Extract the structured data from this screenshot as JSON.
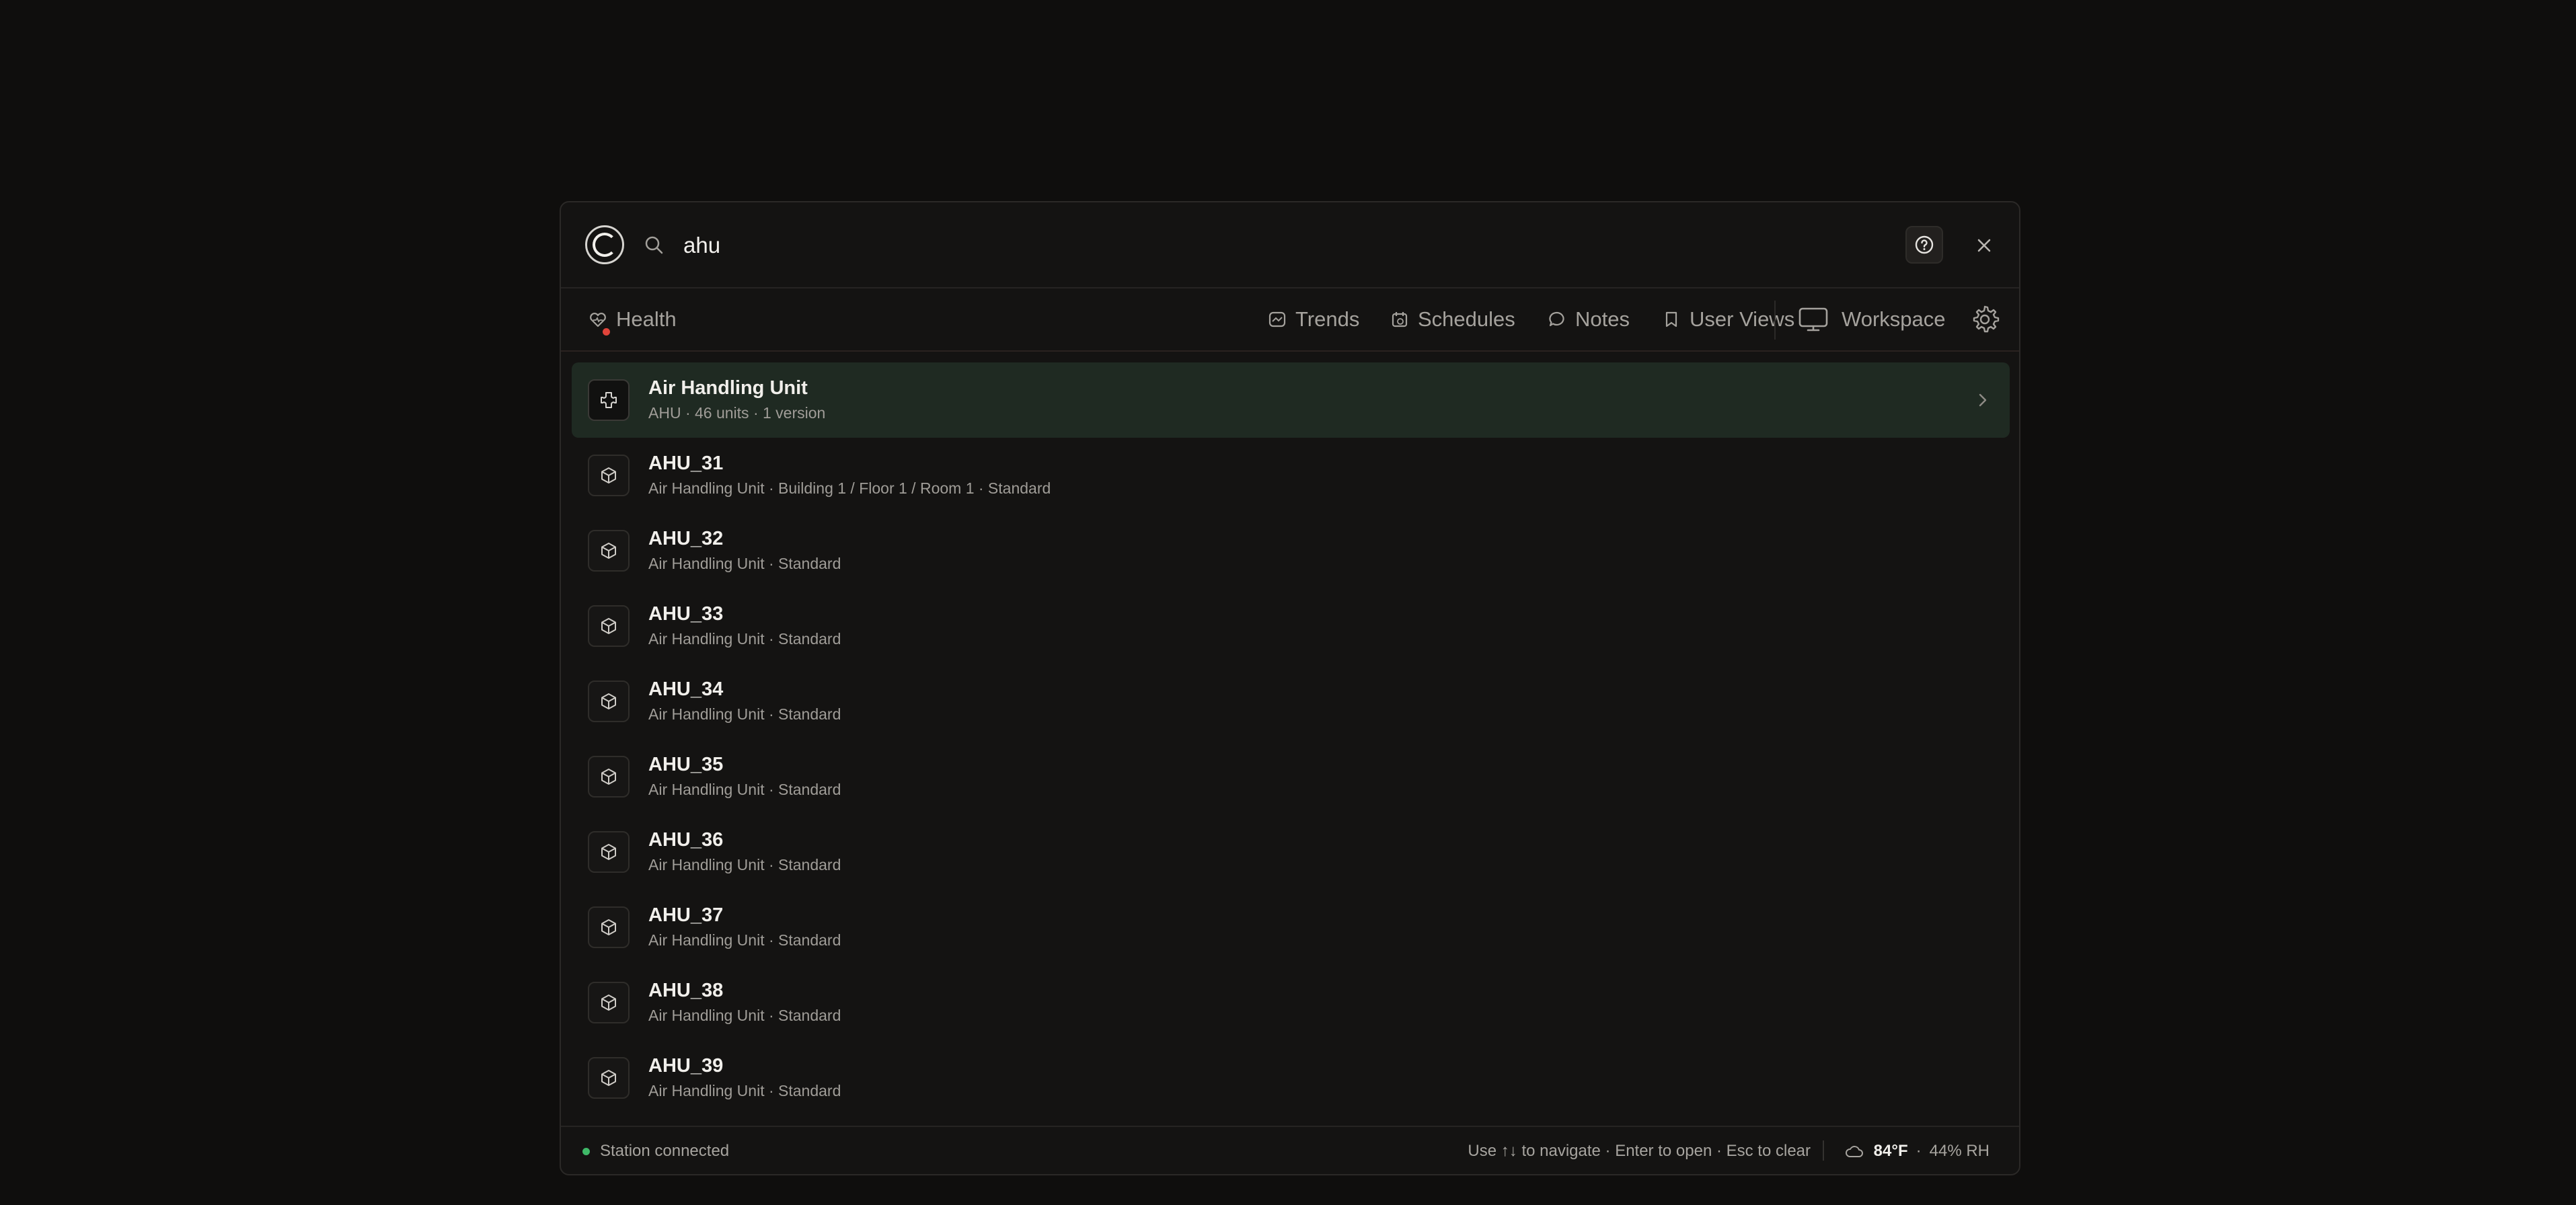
{
  "search": {
    "value": "ahu",
    "placeholder": "Search"
  },
  "tabs": [
    {
      "label": "Health",
      "icon": "health-heart-icon",
      "alert": true
    },
    {
      "label": "Trends",
      "icon": "trends-icon"
    },
    {
      "label": "Schedules",
      "icon": "calendar-icon"
    },
    {
      "label": "Notes",
      "icon": "chat-bubble-icon"
    },
    {
      "label": "User Views",
      "icon": "bookmark-icon"
    }
  ],
  "workspace": {
    "label": "Workspace",
    "icon": "monitor-icon"
  },
  "results": [
    {
      "title": "Air Handling Unit",
      "subtitle": "AHU · 46 units · 1 version",
      "icon": "puzzle-icon",
      "selected": true
    },
    {
      "title": "AHU_31",
      "subtitle": "Air Handling Unit · Building 1 / Floor 1 / Room 1 · Standard",
      "icon": "cube-icon"
    },
    {
      "title": "AHU_32",
      "subtitle": "Air Handling Unit · Standard",
      "icon": "cube-icon"
    },
    {
      "title": "AHU_33",
      "subtitle": "Air Handling Unit · Standard",
      "icon": "cube-icon"
    },
    {
      "title": "AHU_34",
      "subtitle": "Air Handling Unit · Standard",
      "icon": "cube-icon"
    },
    {
      "title": "AHU_35",
      "subtitle": "Air Handling Unit · Standard",
      "icon": "cube-icon"
    },
    {
      "title": "AHU_36",
      "subtitle": "Air Handling Unit · Standard",
      "icon": "cube-icon"
    },
    {
      "title": "AHU_37",
      "subtitle": "Air Handling Unit · Standard",
      "icon": "cube-icon"
    },
    {
      "title": "AHU_38",
      "subtitle": "Air Handling Unit · Standard",
      "icon": "cube-icon"
    },
    {
      "title": "AHU_39",
      "subtitle": "Air Handling Unit · Standard",
      "icon": "cube-icon"
    }
  ],
  "footer": {
    "status": "Station connected",
    "hint": "Use ↑↓ to navigate · Enter to open · Esc to clear",
    "temperature": "84°F",
    "separator": "·",
    "humidity": "44% RH"
  },
  "colors": {
    "background": "#0f0e0d",
    "panel": "#141312",
    "selected_row": "#1f2a22",
    "status_connected": "#3fb968",
    "alert": "#e0443a"
  }
}
